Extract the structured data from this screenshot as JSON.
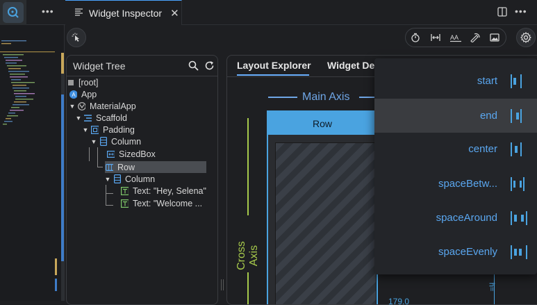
{
  "editor": {
    "tab_title": "Widget Inspector"
  },
  "widget_tree": {
    "title": "Widget Tree",
    "nodes": [
      {
        "label": "[root]",
        "icon": "root-square-icon",
        "depth": 0
      },
      {
        "label": "App",
        "icon": "app-a-icon",
        "depth": 1
      },
      {
        "label": "MaterialApp",
        "icon": "material-app-icon",
        "depth": 1
      },
      {
        "label": "Scaffold",
        "icon": "scaffold-icon",
        "depth": 2
      },
      {
        "label": "Padding",
        "icon": "padding-icon",
        "depth": 3
      },
      {
        "label": "Column",
        "icon": "column-icon",
        "depth": 4
      },
      {
        "label": "SizedBox",
        "icon": "sizedbox-icon",
        "depth": 5
      },
      {
        "label": "Row",
        "icon": "row-icon",
        "depth": 5,
        "selected": true
      },
      {
        "label": "Column",
        "icon": "column-icon",
        "depth": 6
      },
      {
        "label": "Text: \"Hey, Selena\"",
        "icon": "text-icon",
        "depth": 7
      },
      {
        "label": "Text: \"Welcome ...",
        "icon": "text-icon",
        "depth": 7
      }
    ]
  },
  "details": {
    "tabs": [
      "Layout Explorer",
      "Widget Det"
    ],
    "active_tab": "Layout Explorer",
    "main_axis_label": "Main Axis",
    "cross_axis_label": "Cross Axis",
    "widget_box_label": "Row",
    "bottom_value": "179.0",
    "side_value_label": "h="
  },
  "alignment_menu": {
    "options": [
      "start",
      "end",
      "center",
      "spaceBetw...",
      "spaceAround",
      "spaceEvenly"
    ],
    "highlighted": "end"
  },
  "colors": {
    "accent": "#4aa3e0",
    "main_axis": "#6fa6e6",
    "cross_axis": "#a6c94b",
    "menu_text": "#5aa7f0"
  }
}
